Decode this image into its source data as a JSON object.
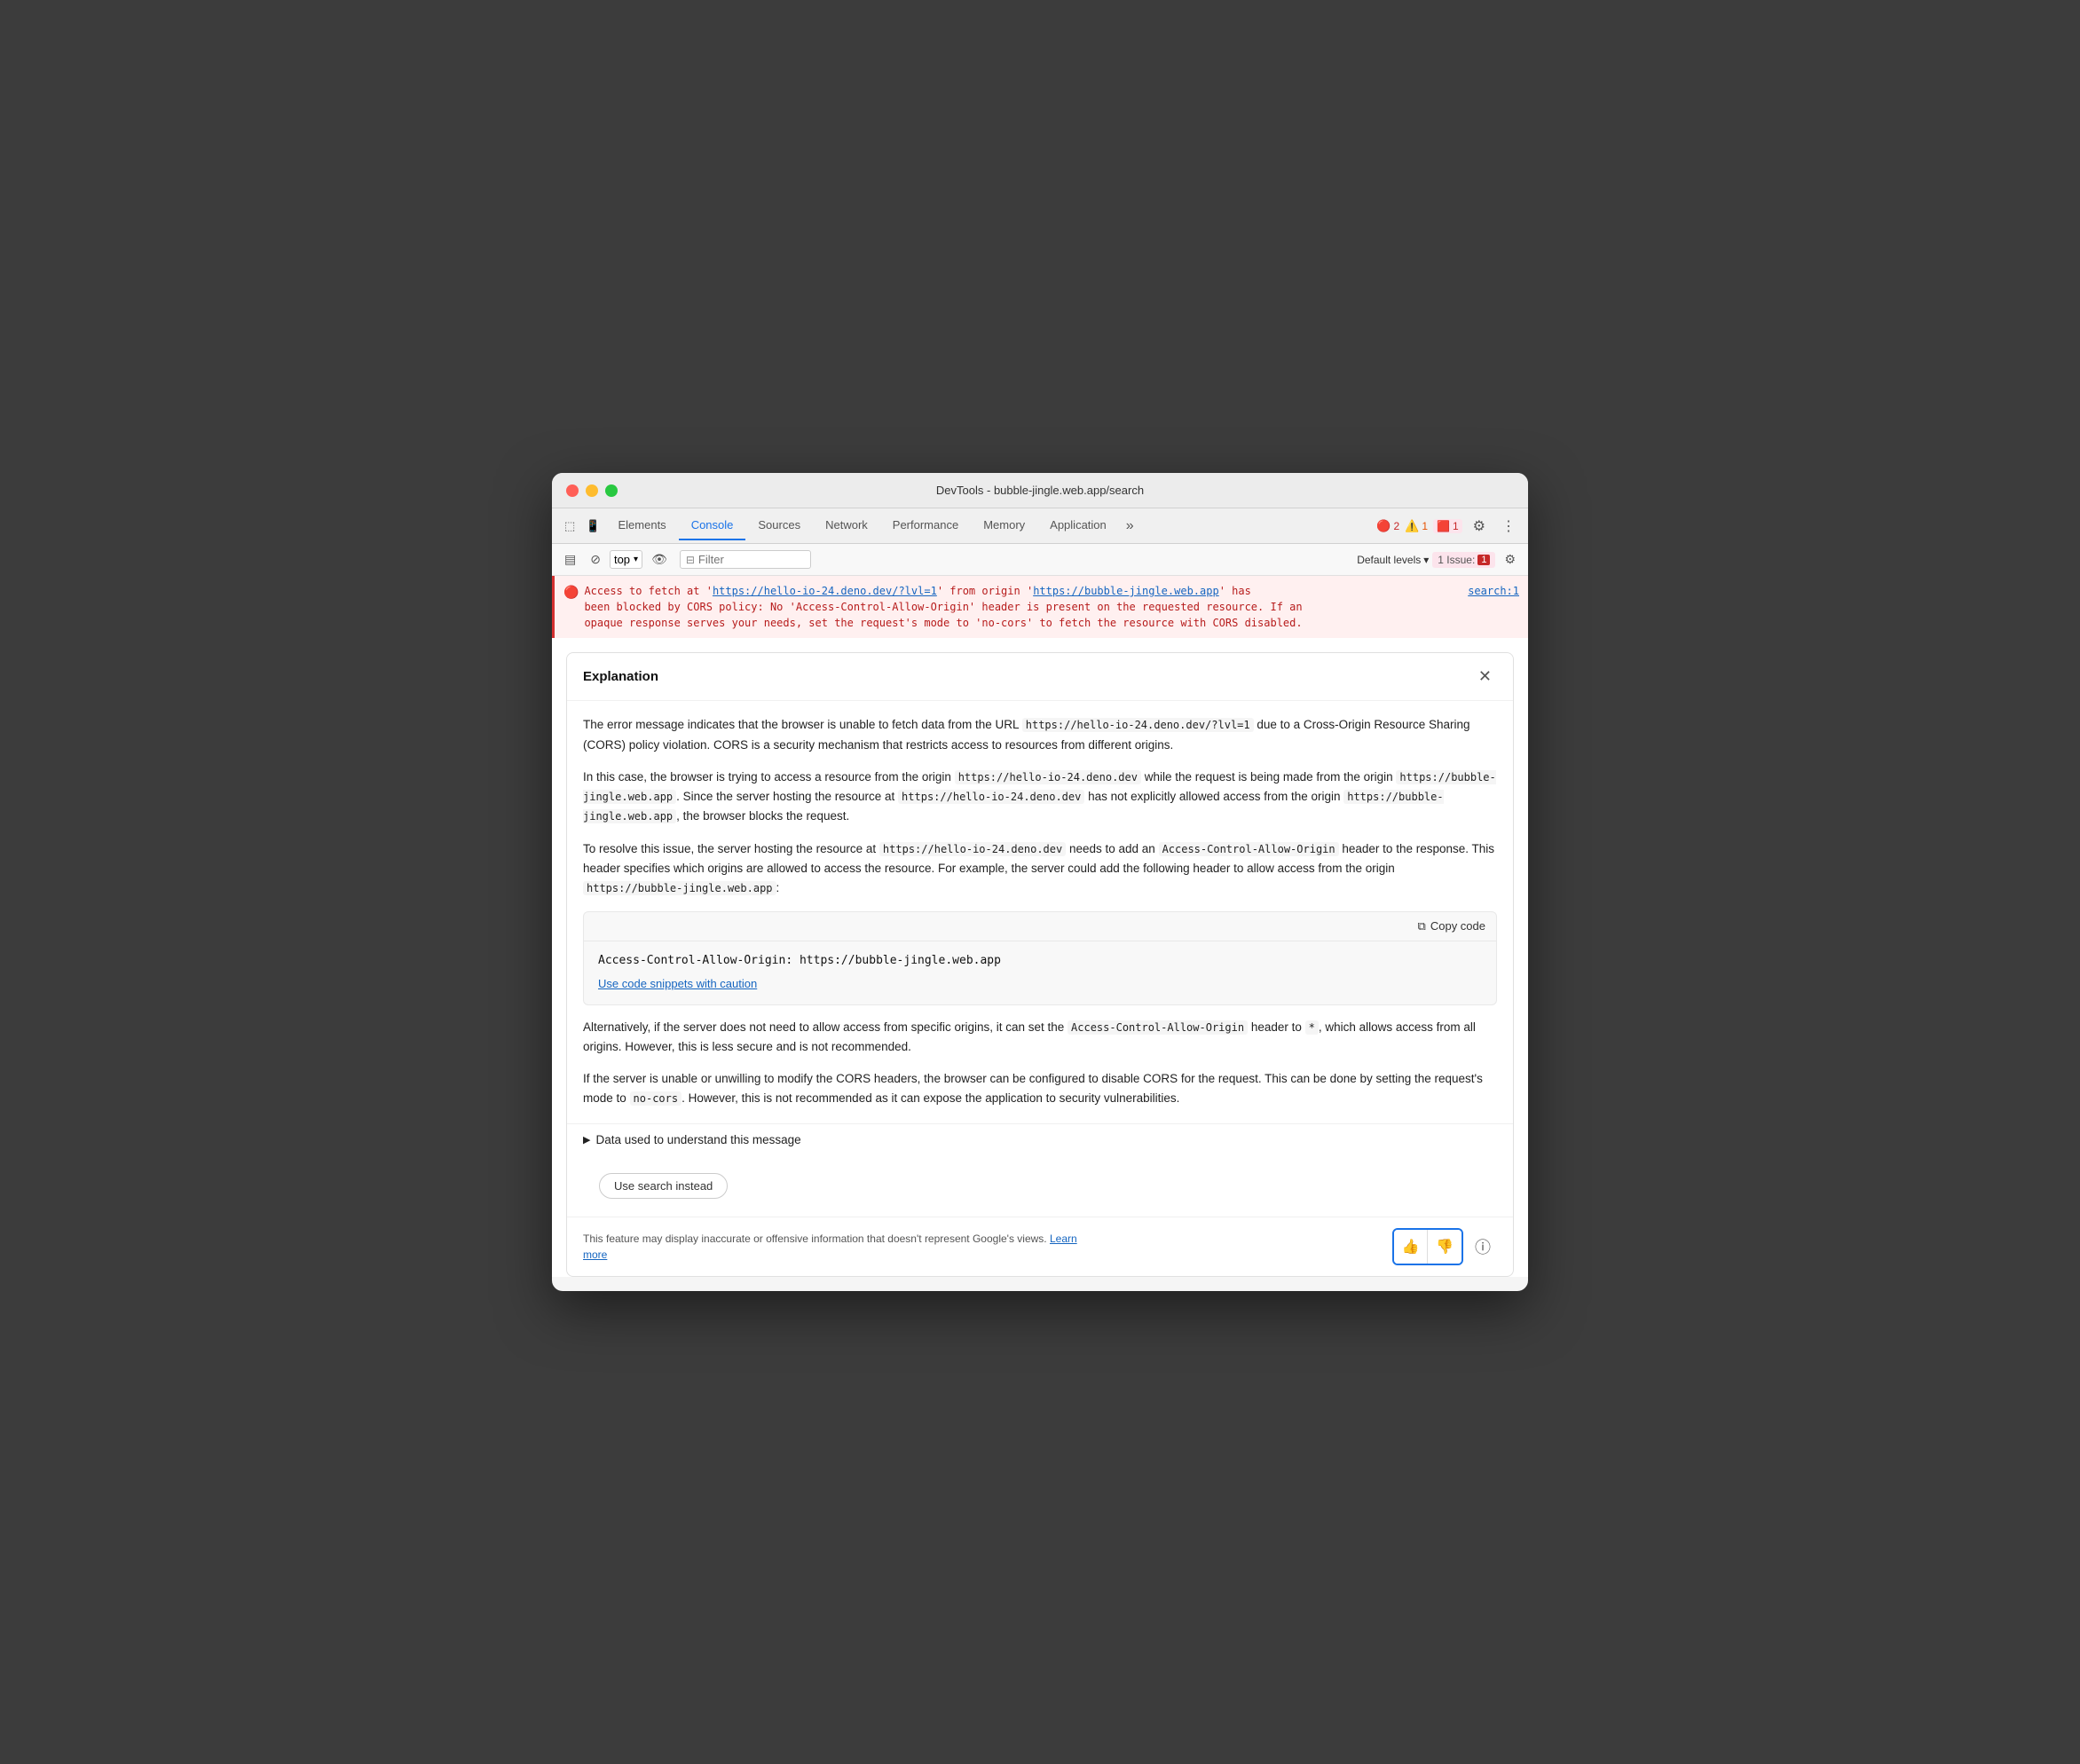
{
  "window": {
    "title": "DevTools - bubble-jingle.web.app/search"
  },
  "tabs": {
    "items": [
      {
        "label": "Elements",
        "active": false
      },
      {
        "label": "Console",
        "active": true
      },
      {
        "label": "Sources",
        "active": false
      },
      {
        "label": "Network",
        "active": false
      },
      {
        "label": "Performance",
        "active": false
      },
      {
        "label": "Memory",
        "active": false
      },
      {
        "label": "Application",
        "active": false
      }
    ],
    "more_label": "»",
    "error_count": "2",
    "warn_count": "1",
    "info_count": "1"
  },
  "console_toolbar": {
    "level_label": "Default levels",
    "issue_label": "1 Issue:",
    "filter_placeholder": "Filter"
  },
  "error_message": {
    "prefix": "Access to fetch at '",
    "url1": "https://hello-io-24.deno.dev/?lvl=1",
    "middle": "' from origin '",
    "url2": "https://bubble-jingle.web.app",
    "suffix": "' has\nbeen blocked by CORS policy: No 'Access-Control-Allow-Origin' header is present on the requested resource. If an\nopaque response serves your needs, set the request's mode to 'no-cors' to fetch the resource with CORS disabled.",
    "source": "search:1"
  },
  "explanation": {
    "title": "Explanation",
    "paragraph1": "The error message indicates that the browser is unable to fetch data from the URL https://hello-io-24.deno.dev/?lvl=1 due to a Cross-Origin Resource Sharing (CORS) policy violation. CORS is a security mechanism that restricts access to resources from different origins.",
    "paragraph2_a": "In this case, the browser is trying to access a resource from the origin ",
    "paragraph2_code1": "https://hello-io-24.deno.dev",
    "paragraph2_b": " while the request is being made from the origin ",
    "paragraph2_code2": "https://bubble-jingle.web.app",
    "paragraph2_c": ". Since the server hosting the resource at ",
    "paragraph2_code3": "https://hello-io-24.deno.dev",
    "paragraph2_d": " has not explicitly allowed access from the origin ",
    "paragraph2_code4": "https://bubble-jingle.web.app",
    "paragraph2_e": ", the browser blocks the request.",
    "paragraph3_a": "To resolve this issue, the server hosting the resource at ",
    "paragraph3_code1": "https://hello-io-24.deno.dev",
    "paragraph3_b": " needs to add an ",
    "paragraph3_code2": "Access-Control-Allow-Origin",
    "paragraph3_c": " header to the response. This header specifies which origins are allowed to access the resource. For example, the server could add the following header to allow access from the origin ",
    "paragraph3_code3": "https://bubble-jingle.web.app",
    "paragraph3_d": ":",
    "copy_code_label": "Copy code",
    "code_snippet": "Access-Control-Allow-Origin: https://bubble-jingle.web.app",
    "caution_link": "Use code snippets with caution",
    "paragraph4_a": "Alternatively, if the server does not need to allow access from specific origins, it can set the ",
    "paragraph4_code1": "Access-Control-Allow-Origin",
    "paragraph4_b": " header to ",
    "paragraph4_code2": "*",
    "paragraph4_c": ", which allows access from all origins. However, this is less secure and is not recommended.",
    "paragraph5_a": "If the server is unable or unwilling to modify the CORS headers, the browser can be configured to disable CORS for the request. This can be done by setting the request's mode to ",
    "paragraph5_code1": "no-cors",
    "paragraph5_b": ". However, this is not recommended as it can expose the application to security vulnerabilities.",
    "data_toggle_label": "Data used to understand this message",
    "use_search_label": "Use search instead",
    "feedback_text": "This feature may display inaccurate or offensive information that doesn't represent Google's views.",
    "learn_more_label": "Learn more"
  }
}
